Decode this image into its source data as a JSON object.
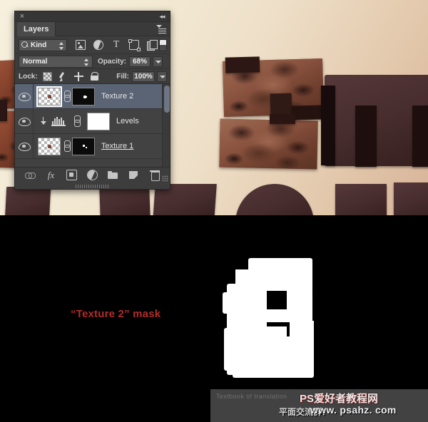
{
  "app": {
    "panel_title": "Layers",
    "close_icon": "×",
    "collapse_icon": "◂◂"
  },
  "filter": {
    "kind_label": "Kind",
    "search_icon": "search-icon",
    "icons": [
      "pixel-layers-filter-icon",
      "adjustment-layers-filter-icon",
      "type-layers-filter-icon",
      "shape-layers-filter-icon",
      "smart-object-filter-icon"
    ],
    "type_glyph": "T",
    "toggle_label": "filter-toggle"
  },
  "blend": {
    "mode": "Normal",
    "opacity_label": "Opacity:",
    "opacity_value": "68%"
  },
  "lock": {
    "label": "Lock:",
    "icons": [
      "lock-transparent-pixels-icon",
      "lock-image-pixels-icon",
      "lock-position-icon",
      "lock-all-icon"
    ],
    "fill_label": "Fill:",
    "fill_value": "100%"
  },
  "layers": [
    {
      "name": "Texture 2",
      "selected": true,
      "visible": true,
      "kind": "pixel-with-mask",
      "underline": false
    },
    {
      "name": "Levels",
      "selected": false,
      "visible": true,
      "kind": "adjustment",
      "underline": false
    },
    {
      "name": "Texture 1",
      "selected": false,
      "visible": true,
      "kind": "pixel-with-mask",
      "underline": true
    }
  ],
  "footer": {
    "icons": [
      "link-layers-icon",
      "layer-style-fx-icon",
      "add-layer-mask-icon",
      "new-adjustment-layer-icon",
      "new-group-icon",
      "new-layer-icon",
      "delete-layer-icon"
    ],
    "fx_glyph": "fx"
  },
  "annotation": {
    "mask_caption": "“Texture 2” mask"
  },
  "watermark": {
    "left_text": "Textbook of translation",
    "site_name": "PS爱好者教程网",
    "url": "www. psahz. com",
    "qq_text": "平面交流群："
  },
  "colors": {
    "panel_bg": "#3d3d3d",
    "selected_row": "#5a6475",
    "annotation_red": "#b22b2b",
    "mask_white": "#ffffff",
    "mask_black": "#000000",
    "artwork_bg_light": "#f6f0dd",
    "artwork_bg_dark": "#d7b398",
    "chocolate_dark": "#3f2523"
  }
}
